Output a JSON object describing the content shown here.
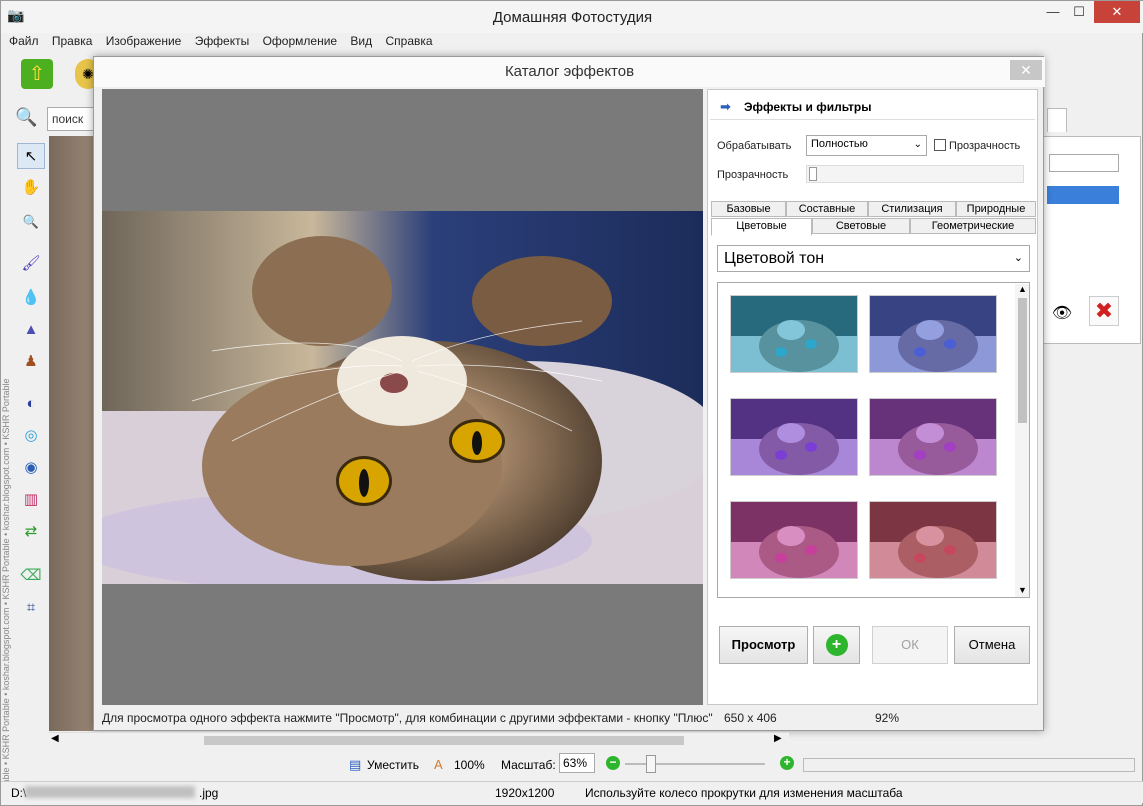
{
  "app": {
    "title": "Домашняя Фотостудия",
    "window_buttons": {
      "minimize": "—",
      "maximize": "☐",
      "close": "✕"
    }
  },
  "menu": [
    "Файл",
    "Правка",
    "Изображение",
    "Эффекты",
    "Оформление",
    "Вид",
    "Справка"
  ],
  "search": {
    "placeholder": "поиск о"
  },
  "sidebar_watermark": "Portable • KSHR Portable • koshar.blogspot.com • KSHR Portable • koshar.blogspot.com • KSHR Portable",
  "dialog": {
    "title": "Каталог эффектов",
    "close": "✕",
    "panel_title": "Эффекты и фильтры",
    "process_label": "Обрабатывать",
    "process_value": "Полностью",
    "transparency_check_label": "Прозрачность",
    "transparency_label": "Прозрачность",
    "tabs_row1": [
      "Базовые",
      "Составные",
      "Стилизация",
      "Природные"
    ],
    "tabs_row2": [
      "Цветовые",
      "Световые",
      "Геометрические"
    ],
    "active_tab": "Цветовые",
    "effect_value": "Цветовой тон",
    "buttons": {
      "preview": "Просмотр",
      "add": "+",
      "ok": "ОК",
      "cancel": "Отмена"
    },
    "status_text": "Для просмотра одного эффекта нажмите \"Просмотр\", для комбинации с другими эффектами - кнопку \"Плюс\"",
    "image_size": "650 x 406",
    "zoom": "92%"
  },
  "zoombar": {
    "fit_label": "Уместить",
    "actual_label": "100%",
    "scale_label": "Масштаб:",
    "scale_value": "63%"
  },
  "statusbar": {
    "file": "D:\\",
    "file_suffix": ".jpg",
    "resolution": "1920x1200",
    "hint": "Используйте колесо прокрутки для изменения масштаба"
  },
  "colors": {
    "accent_blue": "#3a7fd9",
    "close_red": "#c7433a",
    "green": "#2db52d"
  },
  "thumbnails": [
    {
      "name": "cyan-tone",
      "tint": "#2ea6c9"
    },
    {
      "name": "blue-tone",
      "tint": "#4b5fd6"
    },
    {
      "name": "violet-tone",
      "tint": "#7b3fd6"
    },
    {
      "name": "purple-tone",
      "tint": "#a23fc2"
    },
    {
      "name": "magenta-tone",
      "tint": "#c73f9c"
    },
    {
      "name": "rose-tone",
      "tint": "#c7475e"
    }
  ]
}
